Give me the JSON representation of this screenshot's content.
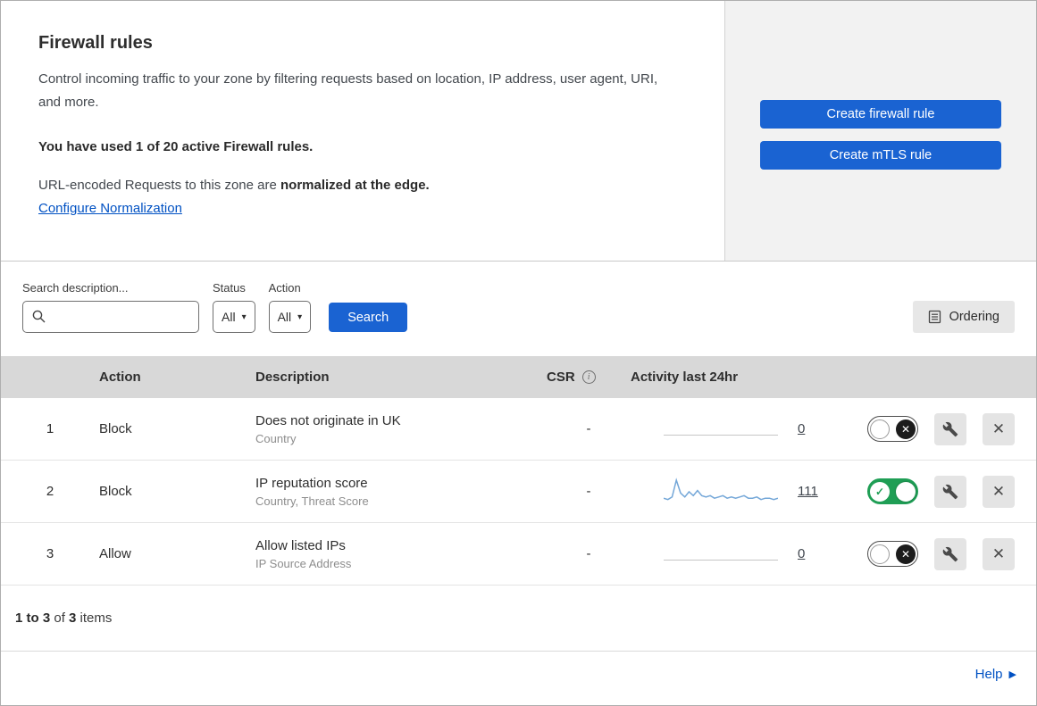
{
  "colors": {
    "primary_button": "#1a63d2",
    "link": "#0051c3",
    "toggle_on": "#1f9e55",
    "sparkline": "#74a7d8",
    "table_header_bg": "#d8d8d8",
    "side_panel_bg": "#f2f2f2"
  },
  "icons": {
    "close": "✕",
    "check": "✓",
    "caret_down": "▾",
    "help_arrow": "▶",
    "info": "i"
  },
  "header": {
    "title": "Firewall rules",
    "description": "Control incoming traffic to your zone by filtering requests based on location, IP address, user agent, URI, and more.",
    "usage_line": "You have used 1 of 20 active Firewall rules.",
    "normalization_prefix": "URL-encoded Requests to this zone are ",
    "normalization_bold": "normalized at the edge.",
    "configure_link": "Configure Normalization",
    "create_firewall_rule_button": "Create firewall rule",
    "create_mtls_rule_button": "Create mTLS rule"
  },
  "filters": {
    "search_label": "Search description...",
    "status_label": "Status",
    "status_value": "All",
    "action_label": "Action",
    "action_value": "All",
    "search_button": "Search",
    "ordering_button": "Ordering"
  },
  "table": {
    "columns": {
      "action": "Action",
      "description": "Description",
      "csr": "CSR",
      "activity": "Activity last 24hr"
    },
    "rows": [
      {
        "index": "1",
        "action": "Block",
        "description": "Does not originate in UK",
        "detail": "Country",
        "csr": "-",
        "activity_count": "0",
        "enabled": false,
        "sparkline": []
      },
      {
        "index": "2",
        "action": "Block",
        "description": "IP reputation score",
        "detail": "Country, Threat Score",
        "csr": "-",
        "activity_count": "111",
        "enabled": true,
        "sparkline": [
          4,
          3,
          5,
          18,
          8,
          5,
          9,
          6,
          10,
          6,
          5,
          6,
          4,
          5,
          6,
          4,
          5,
          4,
          5,
          6,
          4,
          4,
          5,
          3,
          4,
          4,
          3,
          4
        ]
      },
      {
        "index": "3",
        "action": "Allow",
        "description": "Allow listed IPs",
        "detail": "IP Source Address",
        "csr": "-",
        "activity_count": "0",
        "enabled": false,
        "sparkline": []
      }
    ]
  },
  "footer": {
    "range": "1 to 3",
    "of_text": " of ",
    "total": "3",
    "items_text": " items",
    "help_label": "Help"
  }
}
